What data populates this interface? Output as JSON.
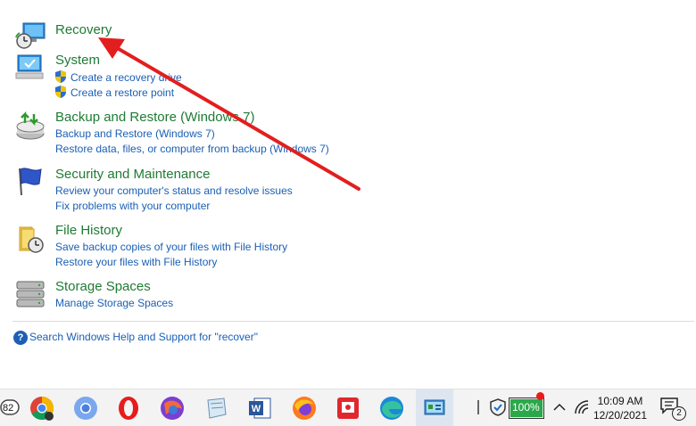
{
  "groups": [
    {
      "title": "Recovery",
      "links": []
    },
    {
      "title": "System",
      "links": [
        "Create a recovery drive",
        "Create a restore point"
      ]
    },
    {
      "title": "Backup and Restore (Windows 7)",
      "links": [
        "Backup and Restore (Windows 7)",
        "Restore data, files, or computer from backup (Windows 7)"
      ]
    },
    {
      "title": "Security and Maintenance",
      "links": [
        "Review your computer's status and resolve issues",
        "Fix problems with your computer"
      ]
    },
    {
      "title": "File History",
      "links": [
        "Save backup copies of your files with File History",
        "Restore your files with File History"
      ]
    },
    {
      "title": "Storage Spaces",
      "links": [
        "Manage Storage Spaces"
      ]
    }
  ],
  "help": {
    "icon": "help-icon",
    "text": "Search Windows Help and Support for \"recover\""
  },
  "annotation": {
    "color": "#e31e1e"
  },
  "taskbar": {
    "badge_count": "82",
    "apps": [
      "chrome-icon",
      "chromium-icon",
      "opera-icon",
      "firefox-dev-icon",
      "notepad-icon",
      "word-icon",
      "firefox-icon",
      "screen-recorder-icon",
      "edge-icon",
      "control-panel-icon"
    ],
    "battery": "100%",
    "time": "10:09 AM",
    "date": "12/20/2021",
    "notifications": "2"
  }
}
